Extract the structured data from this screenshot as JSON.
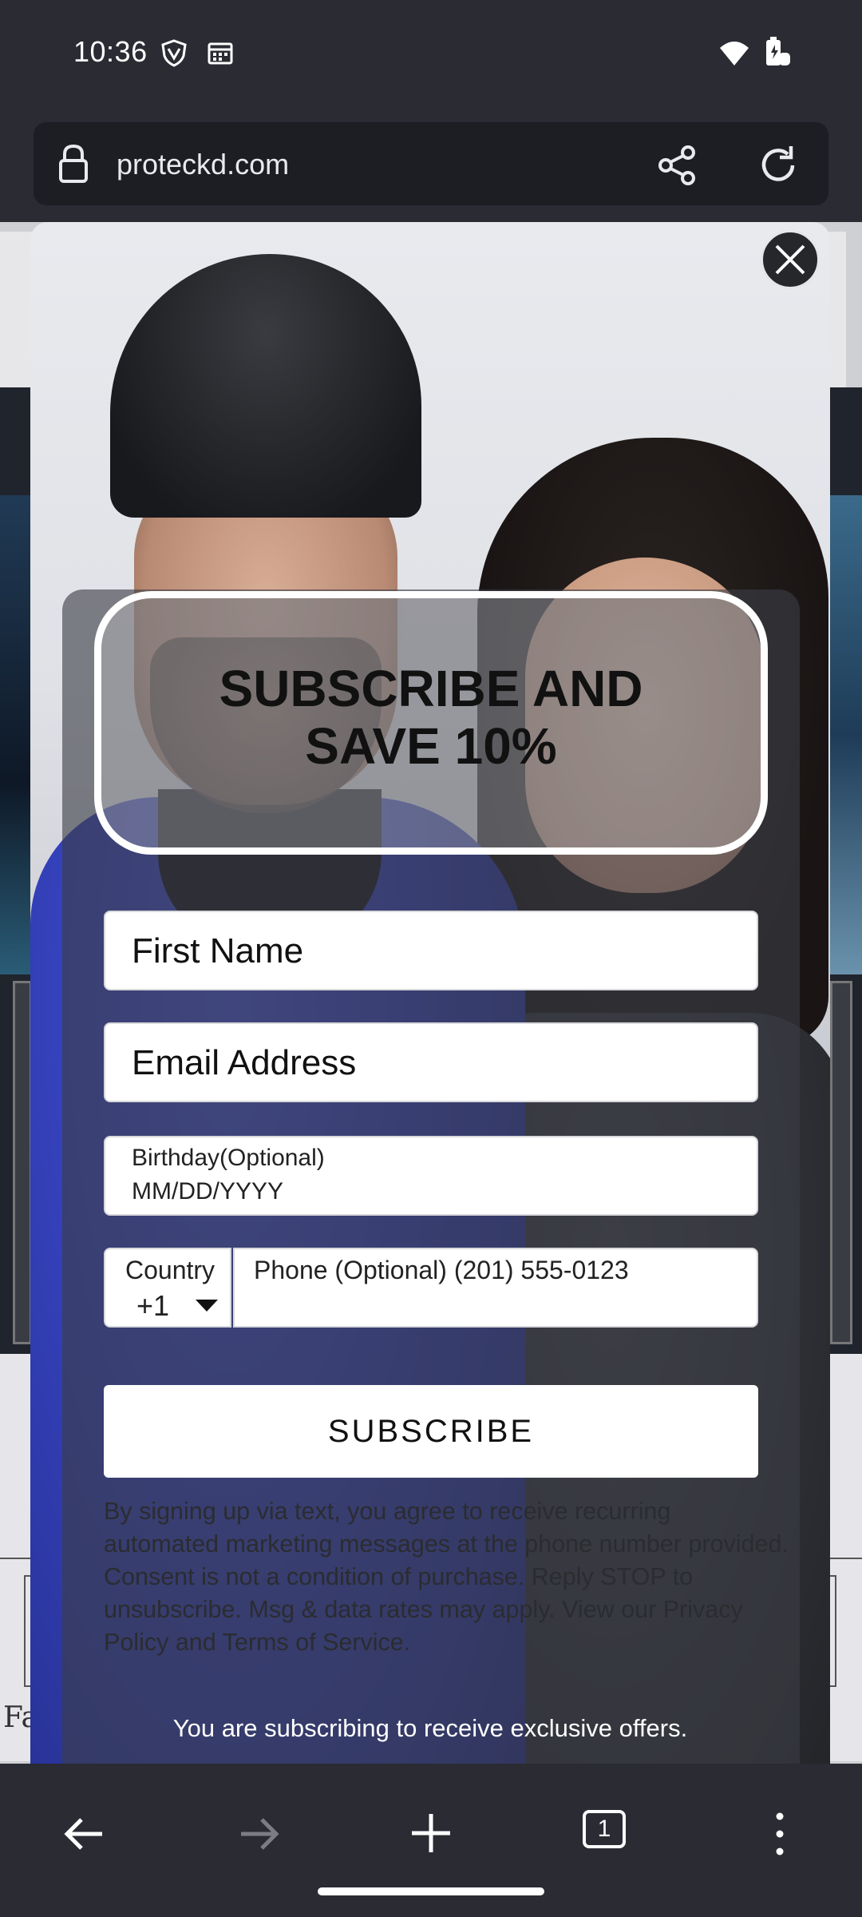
{
  "status_bar": {
    "time": "10:36",
    "icons": [
      "vpn-shield-icon",
      "calendar-icon",
      "wifi-icon",
      "battery-charging-icon"
    ]
  },
  "browser": {
    "url": "proteckd.com",
    "icons": [
      "lock-icon",
      "share-icon",
      "reload-icon"
    ]
  },
  "page_behind": {
    "partial_text": "Fa"
  },
  "popup": {
    "headline_line1": "SUBSCRIBE AND",
    "headline_line2": "SAVE 10%",
    "first_name_placeholder": "First Name",
    "email_placeholder": "Email Address",
    "birthday_label": "Birthday(Optional)",
    "birthday_placeholder": "MM/DD/YYYY",
    "country_label": "Country",
    "country_code": "+1",
    "phone_placeholder": "Phone (Optional) (201) 555-0123",
    "subscribe_label": "SUBSCRIBE",
    "legal_text": "By signing up via text, you agree to receive recurring automated marketing messages at the phone number provided. Consent is not a condition of purchase. Reply STOP to unsubscribe. Msg & data rates may apply. View our Privacy Policy and Terms of Service.",
    "footer_note": "You are subscribing to receive exclusive offers."
  },
  "nav_bar": {
    "tab_count": "1",
    "icons": [
      "back-arrow-icon",
      "forward-arrow-icon",
      "new-tab-plus-icon",
      "tab-switcher-icon",
      "more-menu-icon"
    ]
  }
}
